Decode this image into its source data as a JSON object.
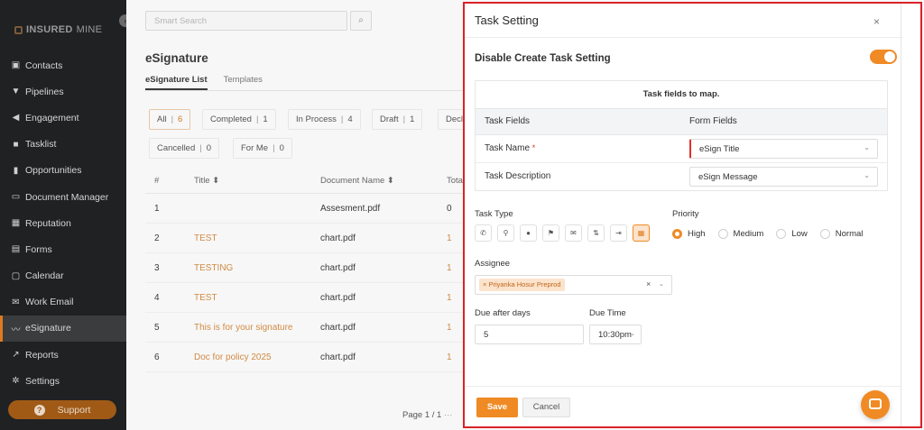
{
  "sidebar": {
    "logo_bold": "INSURED",
    "logo_light": "MINE",
    "items": [
      {
        "label": "Contacts",
        "icon": "contacts-icon",
        "glyph": "▣"
      },
      {
        "label": "Pipelines",
        "icon": "pipelines-icon",
        "glyph": "▼"
      },
      {
        "label": "Engagement",
        "icon": "megaphone-icon",
        "glyph": "◀"
      },
      {
        "label": "Tasklist",
        "icon": "tasklist-icon",
        "glyph": "■"
      },
      {
        "label": "Opportunities",
        "icon": "bar-chart-icon",
        "glyph": "▮"
      },
      {
        "label": "Document Manager",
        "icon": "folder-icon",
        "glyph": "▭"
      },
      {
        "label": "Reputation",
        "icon": "reputation-icon",
        "glyph": "▦"
      },
      {
        "label": "Forms",
        "icon": "forms-icon",
        "glyph": "▤"
      },
      {
        "label": "Calendar",
        "icon": "calendar-icon",
        "glyph": "▢"
      },
      {
        "label": "Work Email",
        "icon": "mail-icon",
        "glyph": "✉"
      },
      {
        "label": "eSignature",
        "icon": "signature-icon",
        "glyph": "〰"
      },
      {
        "label": "Reports",
        "icon": "line-chart-icon",
        "glyph": "↗"
      },
      {
        "label": "Settings",
        "icon": "gear-icon",
        "glyph": "✲"
      }
    ],
    "support_label": "Support"
  },
  "main": {
    "search_placeholder": "Smart Search",
    "page_title": "eSignature",
    "tabs": [
      {
        "label": "eSignature List"
      },
      {
        "label": "Templates"
      }
    ],
    "filters": [
      {
        "label": "All",
        "count": "6"
      },
      {
        "label": "Completed",
        "count": "1"
      },
      {
        "label": "In Process",
        "count": "4"
      },
      {
        "label": "Draft",
        "count": "1"
      },
      {
        "label": "Decli",
        "count": ""
      },
      {
        "label": "Cancelled",
        "count": "0"
      },
      {
        "label": "For Me",
        "count": "0"
      }
    ],
    "columns": {
      "num": "#",
      "title": "Title ⬍",
      "doc": "Document Name ⬍",
      "total": "Tota"
    },
    "rows": [
      {
        "num": "1",
        "title": "",
        "doc": "Assesment.pdf",
        "total": "0"
      },
      {
        "num": "2",
        "title": "TEST",
        "doc": "chart.pdf",
        "total": "1"
      },
      {
        "num": "3",
        "title": "TESTING",
        "doc": "chart.pdf",
        "total": "1"
      },
      {
        "num": "4",
        "title": "TEST",
        "doc": "chart.pdf",
        "total": "1"
      },
      {
        "num": "5",
        "title": "This is for your signature",
        "doc": "chart.pdf",
        "total": "1"
      },
      {
        "num": "6",
        "title": "Doc for policy 2025",
        "doc": "chart.pdf",
        "total": "1"
      }
    ],
    "pager": "Page 1 / 1"
  },
  "modal": {
    "title": "Task Setting",
    "close": "×",
    "disable_label": "Disable Create Task Setting",
    "toggle_on": true,
    "map_title": "Task fields to map.",
    "task_fields_header": "Task Fields",
    "form_fields_header": "Form Fields",
    "mappings": [
      {
        "task_field": "Task Name",
        "required": "*",
        "form_field": "eSign Title"
      },
      {
        "task_field": "Task Description",
        "required": "",
        "form_field": "eSign Message"
      }
    ],
    "task_type_label": "Task Type",
    "task_types": [
      {
        "icon": "phone-icon",
        "glyph": "✆"
      },
      {
        "icon": "meeting-icon",
        "glyph": "⚲"
      },
      {
        "icon": "clock-icon",
        "glyph": "●"
      },
      {
        "icon": "flag-icon",
        "glyph": "⚑"
      },
      {
        "icon": "email-icon",
        "glyph": "✉"
      },
      {
        "icon": "sort-icon",
        "glyph": "⇅"
      },
      {
        "icon": "exit-icon",
        "glyph": "⇥"
      },
      {
        "icon": "task-icon",
        "glyph": "▦"
      }
    ],
    "active_task_type": 7,
    "priority_label": "Priority",
    "priorities": [
      "High",
      "Medium",
      "Low",
      "Normal"
    ],
    "selected_priority": "High",
    "assignee_label": "Assignee",
    "assignee_tag": "Priyanka Hosur Preprod",
    "assignee_clear": "×",
    "due_days_label": "Due after days",
    "due_days_value": "5",
    "due_time_label": "Due Time",
    "due_time_value": "10:30pm",
    "save_label": "Save",
    "cancel_label": "Cancel"
  },
  "colors": {
    "accent": "#f08a24",
    "highlight_border": "#d9222a",
    "sidebar_bg": "#1f2123"
  }
}
